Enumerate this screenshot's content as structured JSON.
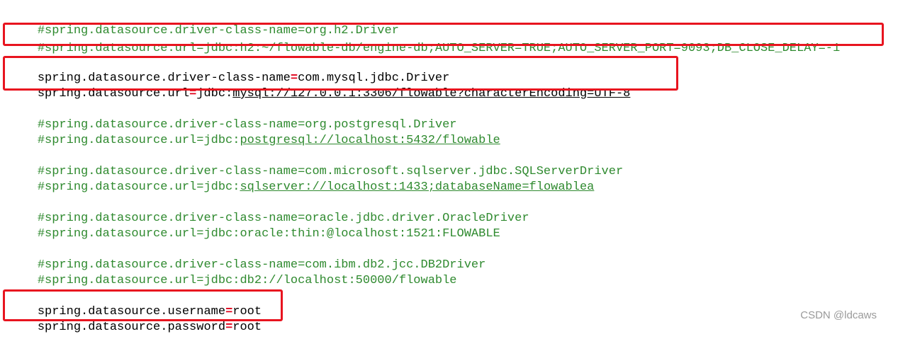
{
  "editor": {
    "lines": {
      "l1": "#spring.datasource.driver-class-name=org.h2.Driver",
      "l2": "#spring.datasource.url=jdbc:h2:~/flowable-db/engine-db;AUTO_SERVER=TRUE;AUTO_SERVER_PORT=9093;DB_CLOSE_DELAY=-1",
      "l3_key": "spring.datasource.driver-class-name",
      "l3_eq": "=",
      "l3_val": "com.mysql.jdbc.Driver",
      "l4_key": "spring.datasource.url",
      "l4_eq": "=",
      "l4_val_a": "jdbc:",
      "l4_val_b": "mysql://127.0.0.1:3306/flowable?characterEncoding=UTF-8",
      "l5": "#spring.datasource.driver-class-name=org.postgresql.Driver",
      "l6_a": "#spring.datasource.url=jdbc:",
      "l6_b": "postgresql://localhost:5432/flowable",
      "l7": "#spring.datasource.driver-class-name=com.microsoft.sqlserver.jdbc.SQLServerDriver",
      "l8_a": "#spring.datasource.url=jdbc:",
      "l8_b": "sqlserver://localhost:1433;databaseName=flowablea",
      "l9": "#spring.datasource.driver-class-name=oracle.jdbc.driver.OracleDriver",
      "l10": "#spring.datasource.url=jdbc:oracle:thin:@localhost:1521:FLOWABLE",
      "l11": "#spring.datasource.driver-class-name=com.ibm.db2.jcc.DB2Driver",
      "l12": "#spring.datasource.url=jdbc:db2://localhost:50000/flowable",
      "l13_key": "spring.datasource.username",
      "l13_eq": "=",
      "l13_val": "root",
      "l14_key": "spring.datasource.password",
      "l14_eq": "=",
      "l14_val": "root"
    }
  },
  "watermark": "CSDN @ldcaws",
  "colors": {
    "comment": "#2f8a2f",
    "text": "#000000",
    "operator": "#e0001a",
    "highlight_box": "#e8141f"
  }
}
